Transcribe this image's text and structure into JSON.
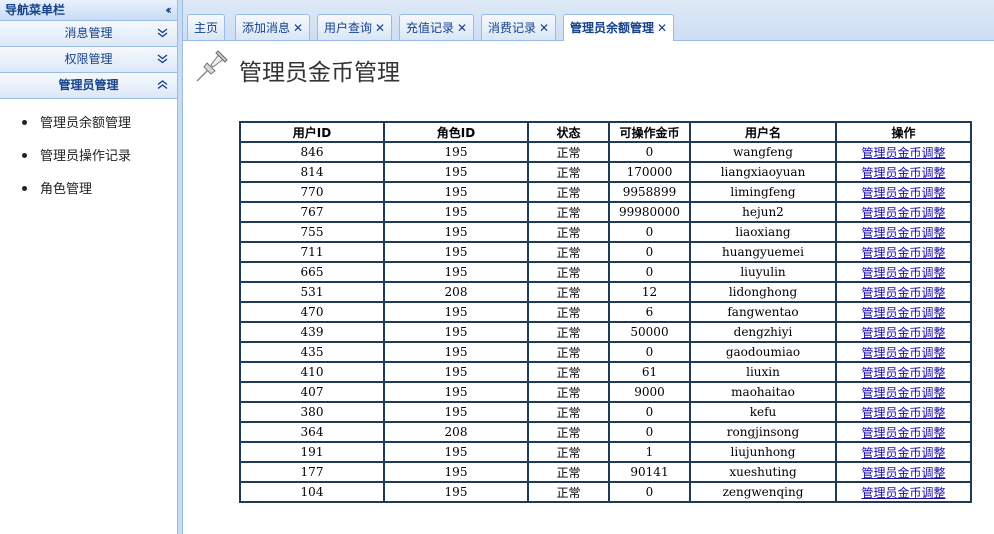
{
  "sidebar": {
    "title": "导航菜单栏",
    "sections": [
      {
        "label": "消息管理",
        "state": "collapsed"
      },
      {
        "label": "权限管理",
        "state": "collapsed"
      },
      {
        "label": "管理员管理",
        "state": "expanded"
      }
    ],
    "items": [
      {
        "label": "管理员余额管理"
      },
      {
        "label": "管理员操作记录"
      },
      {
        "label": "角色管理"
      }
    ]
  },
  "tabs": [
    {
      "label": "主页",
      "closable": false
    },
    {
      "label": "添加消息",
      "closable": true
    },
    {
      "label": "用户查询",
      "closable": true
    },
    {
      "label": "充值记录",
      "closable": true
    },
    {
      "label": "消费记录",
      "closable": true
    },
    {
      "label": "管理员余额管理",
      "closable": true,
      "active": true
    }
  ],
  "page": {
    "title": "管理员金币管理"
  },
  "table": {
    "columns": [
      "用户ID",
      "角色ID",
      "状态",
      "可操作金币",
      "用户名",
      "操作"
    ],
    "rows": [
      [
        "846",
        "195",
        "正常",
        "0",
        "wangfeng",
        "管理员金币调整"
      ],
      [
        "814",
        "195",
        "正常",
        "170000",
        "liangxiaoyuan",
        "管理员金币调整"
      ],
      [
        "770",
        "195",
        "正常",
        "9958899",
        "limingfeng",
        "管理员金币调整"
      ],
      [
        "767",
        "195",
        "正常",
        "99980000",
        "hejun2",
        "管理员金币调整"
      ],
      [
        "755",
        "195",
        "正常",
        "0",
        "liaoxiang",
        "管理员金币调整"
      ],
      [
        "711",
        "195",
        "正常",
        "0",
        "huangyuemei",
        "管理员金币调整"
      ],
      [
        "665",
        "195",
        "正常",
        "0",
        "liuyulin",
        "管理员金币调整"
      ],
      [
        "531",
        "208",
        "正常",
        "12",
        "lidonghong",
        "管理员金币调整"
      ],
      [
        "470",
        "195",
        "正常",
        "6",
        "fangwentao",
        "管理员金币调整"
      ],
      [
        "439",
        "195",
        "正常",
        "50000",
        "dengzhiyi",
        "管理员金币调整"
      ],
      [
        "435",
        "195",
        "正常",
        "0",
        "gaodoumiao",
        "管理员金币调整"
      ],
      [
        "410",
        "195",
        "正常",
        "61",
        "liuxin",
        "管理员金币调整"
      ],
      [
        "407",
        "195",
        "正常",
        "9000",
        "maohaitao",
        "管理员金币调整"
      ],
      [
        "380",
        "195",
        "正常",
        "0",
        "kefu",
        "管理员金币调整"
      ],
      [
        "364",
        "208",
        "正常",
        "0",
        "rongjinsong",
        "管理员金币调整"
      ],
      [
        "191",
        "195",
        "正常",
        "1",
        "liujunhong",
        "管理员金币调整"
      ],
      [
        "177",
        "195",
        "正常",
        "90141",
        "xueshuting",
        "管理员金币调整"
      ],
      [
        "104",
        "195",
        "正常",
        "0",
        "zengwenqing",
        "管理员金币调整"
      ]
    ]
  },
  "colors": {
    "accent": "#15428b",
    "panel_border": "#99bbe8",
    "table_border": "#1f3a55",
    "link": "#1a0dab"
  }
}
